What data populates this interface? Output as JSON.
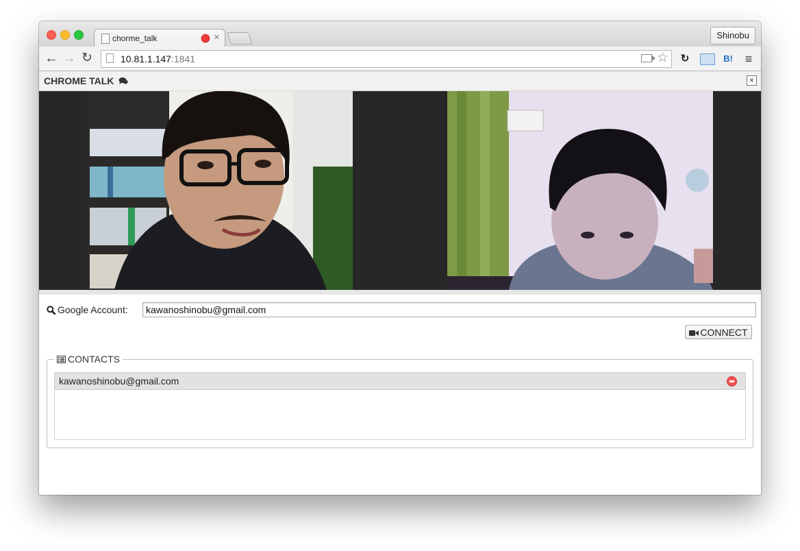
{
  "browser": {
    "tab_title": "chorme_talk",
    "tab_close": "×",
    "profile_name": "Shinobu",
    "url_host": "10.81.1.147",
    "url_port": ":1841",
    "ext_hatena": "B!",
    "ext_sync": "↻",
    "menu_glyph": "≡",
    "nav": {
      "back": "←",
      "forward": "→",
      "reload": "↻"
    },
    "star": "☆"
  },
  "app": {
    "title": "CHROME TALK",
    "close_glyph": "×"
  },
  "account": {
    "label": "Google Account:",
    "value": "kawanoshinobu@gmail.com",
    "icon": "search-icon"
  },
  "connect": {
    "label": "CONNECT",
    "icon": "video-camera-icon"
  },
  "contacts": {
    "legend": "CONTACTS",
    "icon": "list-icon",
    "items": [
      {
        "email": "kawanoshinobu@gmail.com"
      }
    ]
  },
  "colors": {
    "record_indicator": "#f13b3b",
    "video_background": "#272727",
    "remove_button": "#f05050"
  }
}
